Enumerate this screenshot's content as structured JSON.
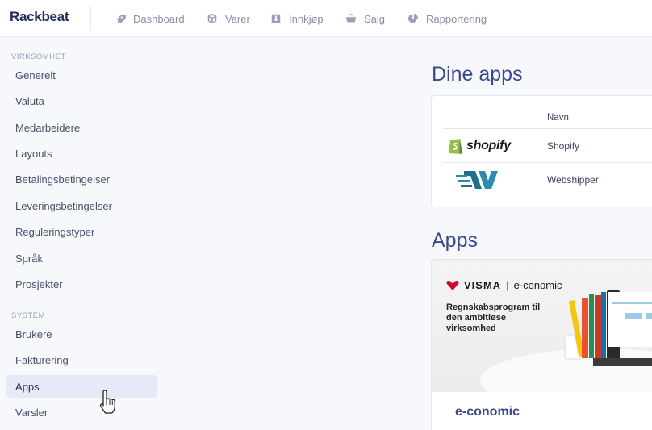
{
  "brand": {
    "name": "Rackbeat"
  },
  "topnav": [
    {
      "label": "Dashboard",
      "icon": "rocket-icon"
    },
    {
      "label": "Varer",
      "icon": "box-icon"
    },
    {
      "label": "Innkjøp",
      "icon": "download-icon"
    },
    {
      "label": "Salg",
      "icon": "basket-icon"
    },
    {
      "label": "Rapportering",
      "icon": "pie-chart-icon"
    }
  ],
  "sidebar": {
    "sections": [
      {
        "title": "VIRKSOMHET",
        "items": [
          "Generelt",
          "Valuta",
          "Medarbeidere",
          "Layouts",
          "Betalingsbetingelser",
          "Leveringsbetingelser",
          "Reguleringstyper",
          "Språk",
          "Prosjekter"
        ]
      },
      {
        "title": "SYSTEM",
        "items": [
          "Brukere",
          "Fakturering",
          "Apps",
          "Varsler"
        ]
      }
    ],
    "active": "Apps"
  },
  "main": {
    "your_apps_title": "Dine apps",
    "table_header": "Navn",
    "installed_apps": [
      {
        "logo_text": "shopify",
        "name": "Shopify"
      },
      {
        "logo_text": "",
        "name": "Webshipper"
      }
    ],
    "apps_title": "Apps",
    "promo": {
      "brand_visma": "VISMA",
      "brand_sep": "|",
      "brand_product": "e·conomic",
      "tagline": "Regnskabsprogram til den ambitiøse virksomhed",
      "title": "e-conomic"
    }
  },
  "colors": {
    "accent": "#3b4a8c",
    "active_bg": "#e6e9f7",
    "shopify_green": "#95bf47",
    "webshipper_teal": "#1f6f8b"
  }
}
